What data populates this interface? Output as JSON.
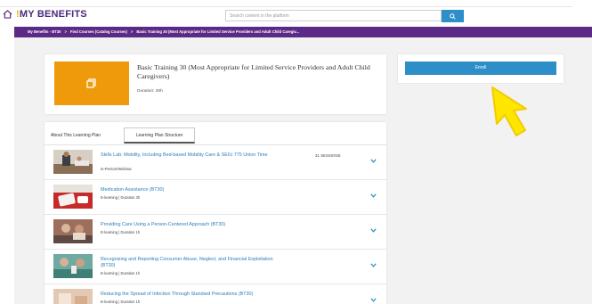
{
  "header": {
    "logo_prefix": "!",
    "logo_text": "MY BENEFITS",
    "search_placeholder": "Search content in the platform"
  },
  "breadcrumb": [
    "My Benefits - BT30",
    "Find Courses (Catalog Courses)",
    "Basic Training 30 (Most Appropriate for Limited Service Providers and Adult Child Caregiv..."
  ],
  "course": {
    "title": "Basic Training 30 (Most Appropriate for Limited Service Providers and Adult Child Caregivers)",
    "duration": "Duration: 30h"
  },
  "enroll_label": "Enroll",
  "tabs": {
    "about": "About This Learning Plan",
    "structure": "Learning Plan Structure"
  },
  "items": [
    {
      "title": "Skills Lab: Mobility, Including Bed-based Mobility Care & SEIU 775 Union Time",
      "meta": "In-Person/Webinar",
      "sessions": "31 SESSIONS"
    },
    {
      "title": "Medication Assistance (BT30)",
      "meta": "E-learning | Duration 3h",
      "sessions": ""
    },
    {
      "title": "Providing Care Using a Person-Centered Approach (BT30)",
      "meta": "E-learning | Duration 1h",
      "sessions": ""
    },
    {
      "title": "Recognizing and Reporting Consumer Abuse, Neglect, and Financial Exploitation (BT30)",
      "meta": "E-learning | Duration 1h",
      "sessions": ""
    },
    {
      "title": "Reducing the Spread of Infection Through Standard Precautions (BT30)",
      "meta": "E-learning | Duration 1h",
      "sessions": ""
    }
  ],
  "colors": {
    "brand_purple": "#5b2a86",
    "accent_blue": "#2e8ec8",
    "thumb_orange": "#ef9a0a",
    "cursor_yellow": "#ffe600"
  }
}
